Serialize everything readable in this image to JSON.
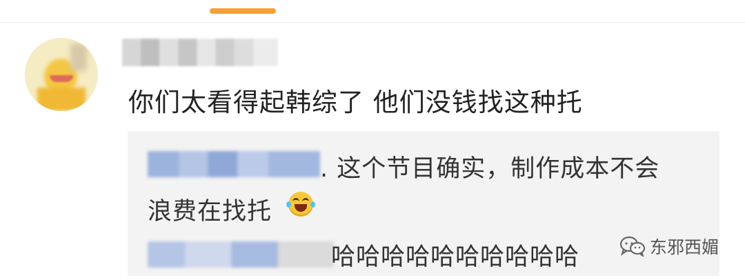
{
  "comment": {
    "text": "你们太看得起韩综了 他们没钱找这种托"
  },
  "replies": [
    {
      "text_line1": ". 这个节目确实，制作成本不会",
      "text_line2": "浪费在找托"
    },
    {
      "text": "哈哈哈哈哈哈哈哈哈哈"
    }
  ],
  "watermark": {
    "text": "东邪西媚"
  },
  "icons": {
    "avatar": "cartoon-avatar (blurred)",
    "emoji": "laughing-with-tears-emoji",
    "watermark": "wechat-icon"
  },
  "colors": {
    "tab_indicator": "#f5a035",
    "reply_name": "#7f9ed6",
    "reply_background": "#f3f3f3"
  }
}
